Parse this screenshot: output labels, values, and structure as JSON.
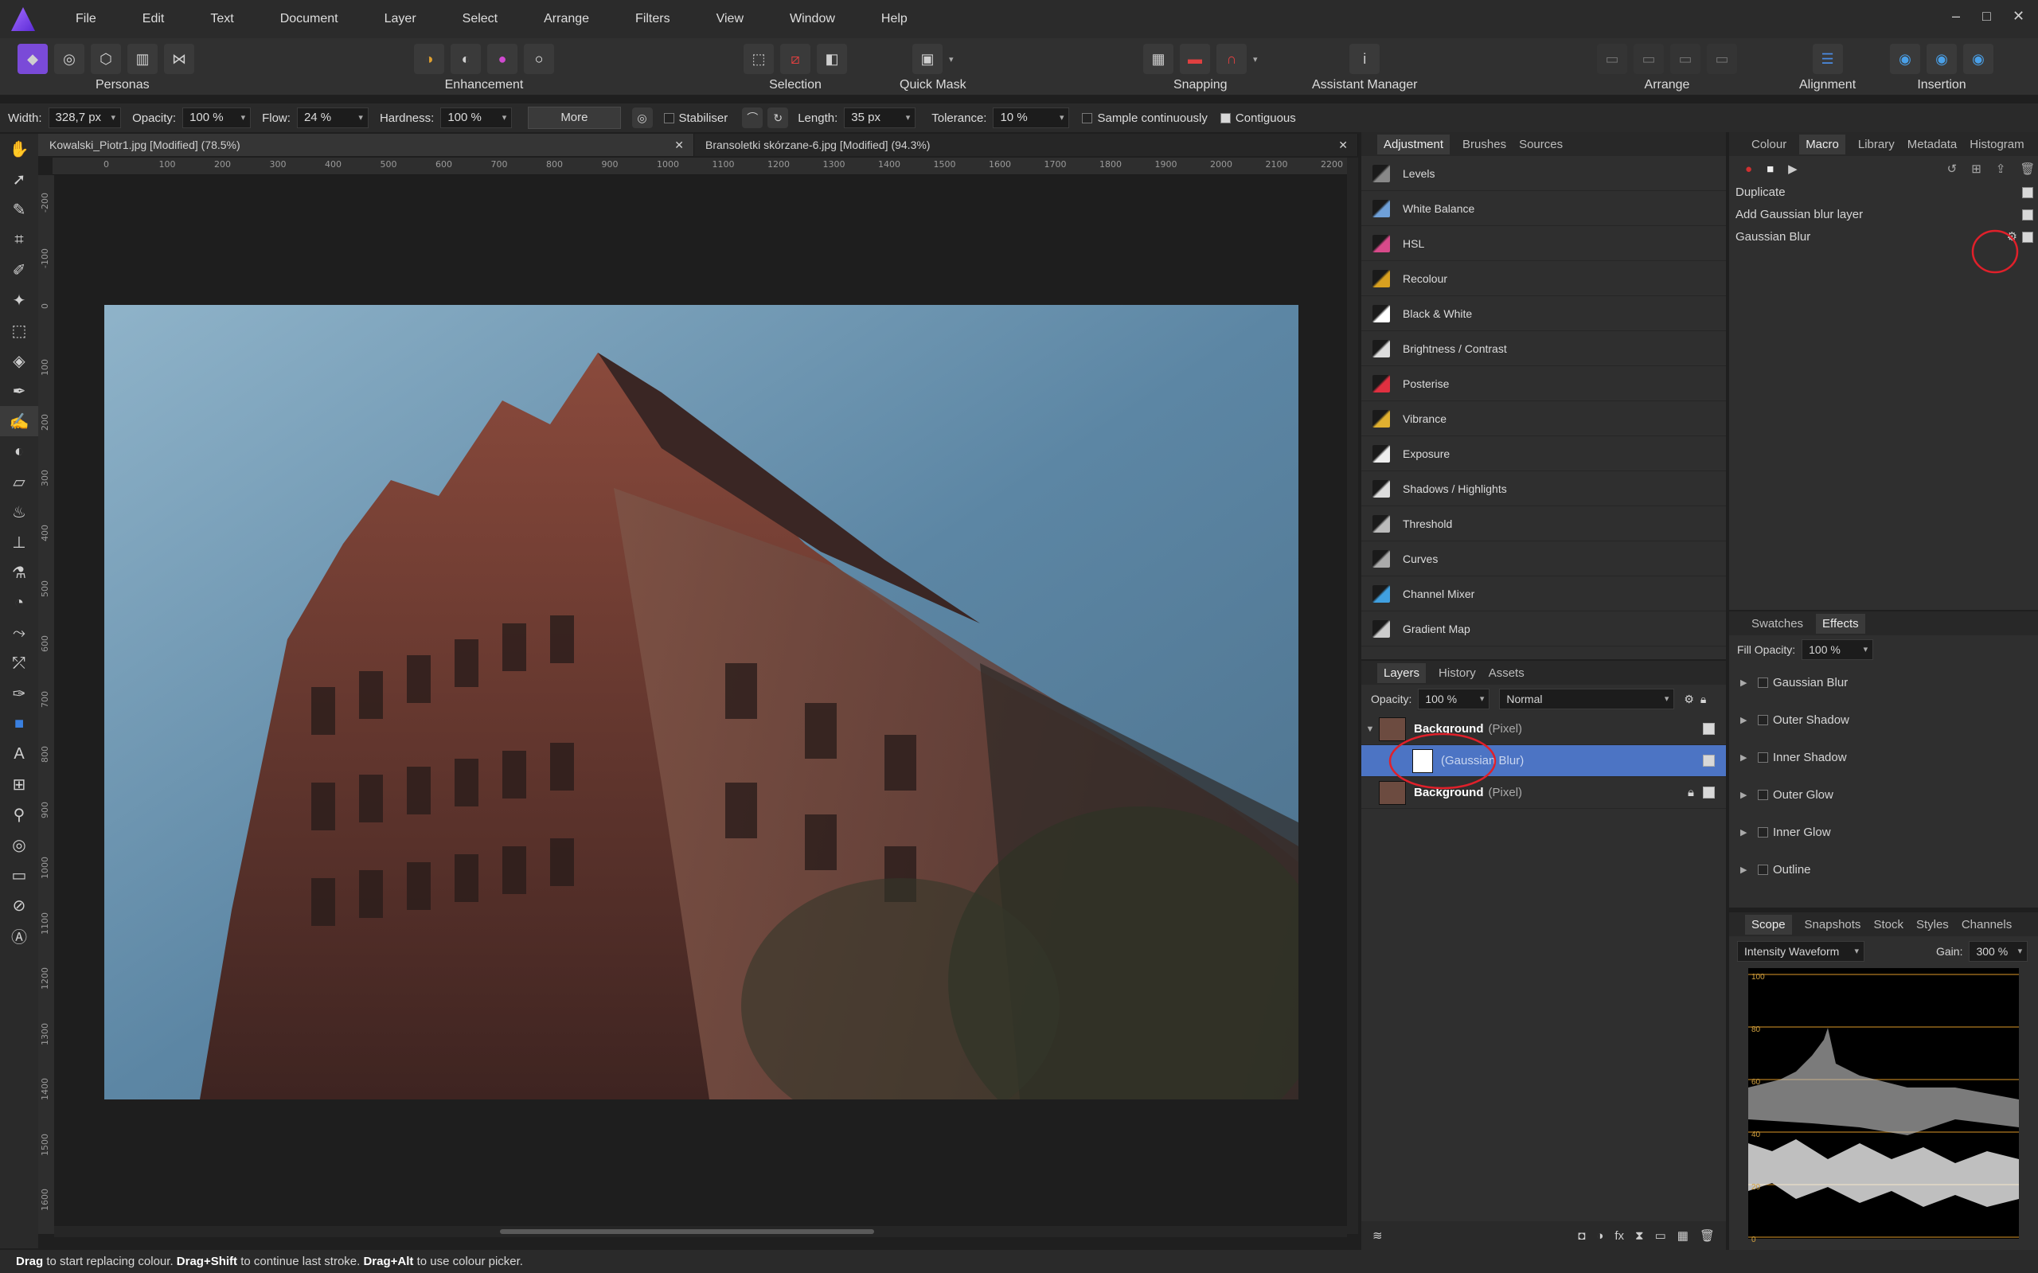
{
  "menu": [
    "File",
    "Edit",
    "Text",
    "Document",
    "Layer",
    "Select",
    "Arrange",
    "Filters",
    "View",
    "Window",
    "Help"
  ],
  "window_controls": {
    "minimize": "–",
    "maximize": "□",
    "close": "✕"
  },
  "toolbar": {
    "personas_label": "Personas",
    "enhancement_label": "Enhancement",
    "selection_label": "Selection",
    "quickmask_label": "Quick Mask",
    "snapping_label": "Snapping",
    "assistant_label": "Assistant Manager",
    "arrange_label": "Arrange",
    "alignment_label": "Alignment",
    "insertion_label": "Insertion"
  },
  "context": {
    "width_label": "Width:",
    "width_value": "328,7 px",
    "opacity_label": "Opacity:",
    "opacity_value": "100 %",
    "flow_label": "Flow:",
    "flow_value": "24 %",
    "hardness_label": "Hardness:",
    "hardness_value": "100 %",
    "more_label": "More",
    "stabiliser_label": "Stabiliser",
    "length_label": "Length:",
    "length_value": "35 px",
    "tolerance_label": "Tolerance:",
    "tolerance_value": "10 %",
    "sample_label": "Sample continuously",
    "contiguous_label": "Contiguous"
  },
  "documents": [
    {
      "title": "Kowalski_Piotr1.jpg [Modified] (78.5%)",
      "close": "✕"
    },
    {
      "title": "Bransoletki skórzane-6.jpg [Modified] (94.3%)",
      "close": "✕"
    }
  ],
  "ruler_top": [
    "0",
    "100",
    "200",
    "300",
    "400",
    "500",
    "600",
    "700",
    "800",
    "900",
    "1000",
    "1100",
    "1200",
    "1300",
    "1400",
    "1500",
    "1600",
    "1700",
    "1800",
    "1900",
    "2000",
    "2100",
    "2200"
  ],
  "ruler_left": [
    "-200",
    "-100",
    "0",
    "100",
    "200",
    "300",
    "400",
    "500",
    "600",
    "700",
    "800",
    "900",
    "1000",
    "1100",
    "1200",
    "1300",
    "1400",
    "1500",
    "1600"
  ],
  "adjustment_tabs": [
    "Adjustment",
    "Brushes",
    "Sources"
  ],
  "adjustments": [
    {
      "label": "Levels",
      "color": "#888888"
    },
    {
      "label": "White Balance",
      "color": "#6fa0d8"
    },
    {
      "label": "HSL",
      "color": "#d84a8a"
    },
    {
      "label": "Recolour",
      "color": "#d8a020"
    },
    {
      "label": "Black & White",
      "color": "#ffffff"
    },
    {
      "label": "Brightness / Contrast",
      "color": "#dddddd"
    },
    {
      "label": "Posterise",
      "color": "#e03040"
    },
    {
      "label": "Vibrance",
      "color": "#e0b030"
    },
    {
      "label": "Exposure",
      "color": "#eeeeee"
    },
    {
      "label": "Shadows / Highlights",
      "color": "#dddddd"
    },
    {
      "label": "Threshold",
      "color": "#bbbbbb"
    },
    {
      "label": "Curves",
      "color": "#aaaaaa"
    },
    {
      "label": "Channel Mixer",
      "color": "#40a0e0"
    },
    {
      "label": "Gradient Map",
      "color": "#cccccc"
    }
  ],
  "layers_tabs": [
    "Layers",
    "History",
    "Assets"
  ],
  "layers": {
    "opacity_label": "Opacity:",
    "opacity_value": "100 %",
    "blend": "Normal",
    "rows": [
      {
        "name": "Background",
        "type": "(Pixel)"
      },
      {
        "name": "(Gaussian Blur)",
        "type": ""
      },
      {
        "name": "Background",
        "type": "(Pixel)"
      }
    ]
  },
  "macro_tabs": [
    "Colour",
    "Macro",
    "Library",
    "Metadata",
    "Histogram"
  ],
  "macro_steps": [
    "Duplicate",
    "Add Gaussian blur layer",
    "Gaussian Blur"
  ],
  "effects_tabs": [
    "Swatches",
    "Effects"
  ],
  "effects": {
    "fill_label": "Fill Opacity:",
    "fill_value": "100 %",
    "items": [
      "Gaussian Blur",
      "Outer Shadow",
      "Inner Shadow",
      "Outer Glow",
      "Inner Glow",
      "Outline"
    ]
  },
  "scope_tabs": [
    "Scope",
    "Snapshots",
    "Stock",
    "Styles",
    "Channels"
  ],
  "scope": {
    "mode": "Intensity Waveform",
    "gain_label": "Gain:",
    "gain_value": "300 %",
    "levels": [
      "100",
      "80",
      "60",
      "40",
      "20",
      "0"
    ]
  },
  "status": {
    "a": "Drag",
    "b": " to start replacing colour. ",
    "c": "Drag+Shift",
    "d": " to continue last stroke. ",
    "e": "Drag+Alt",
    "f": " to use colour picker."
  }
}
